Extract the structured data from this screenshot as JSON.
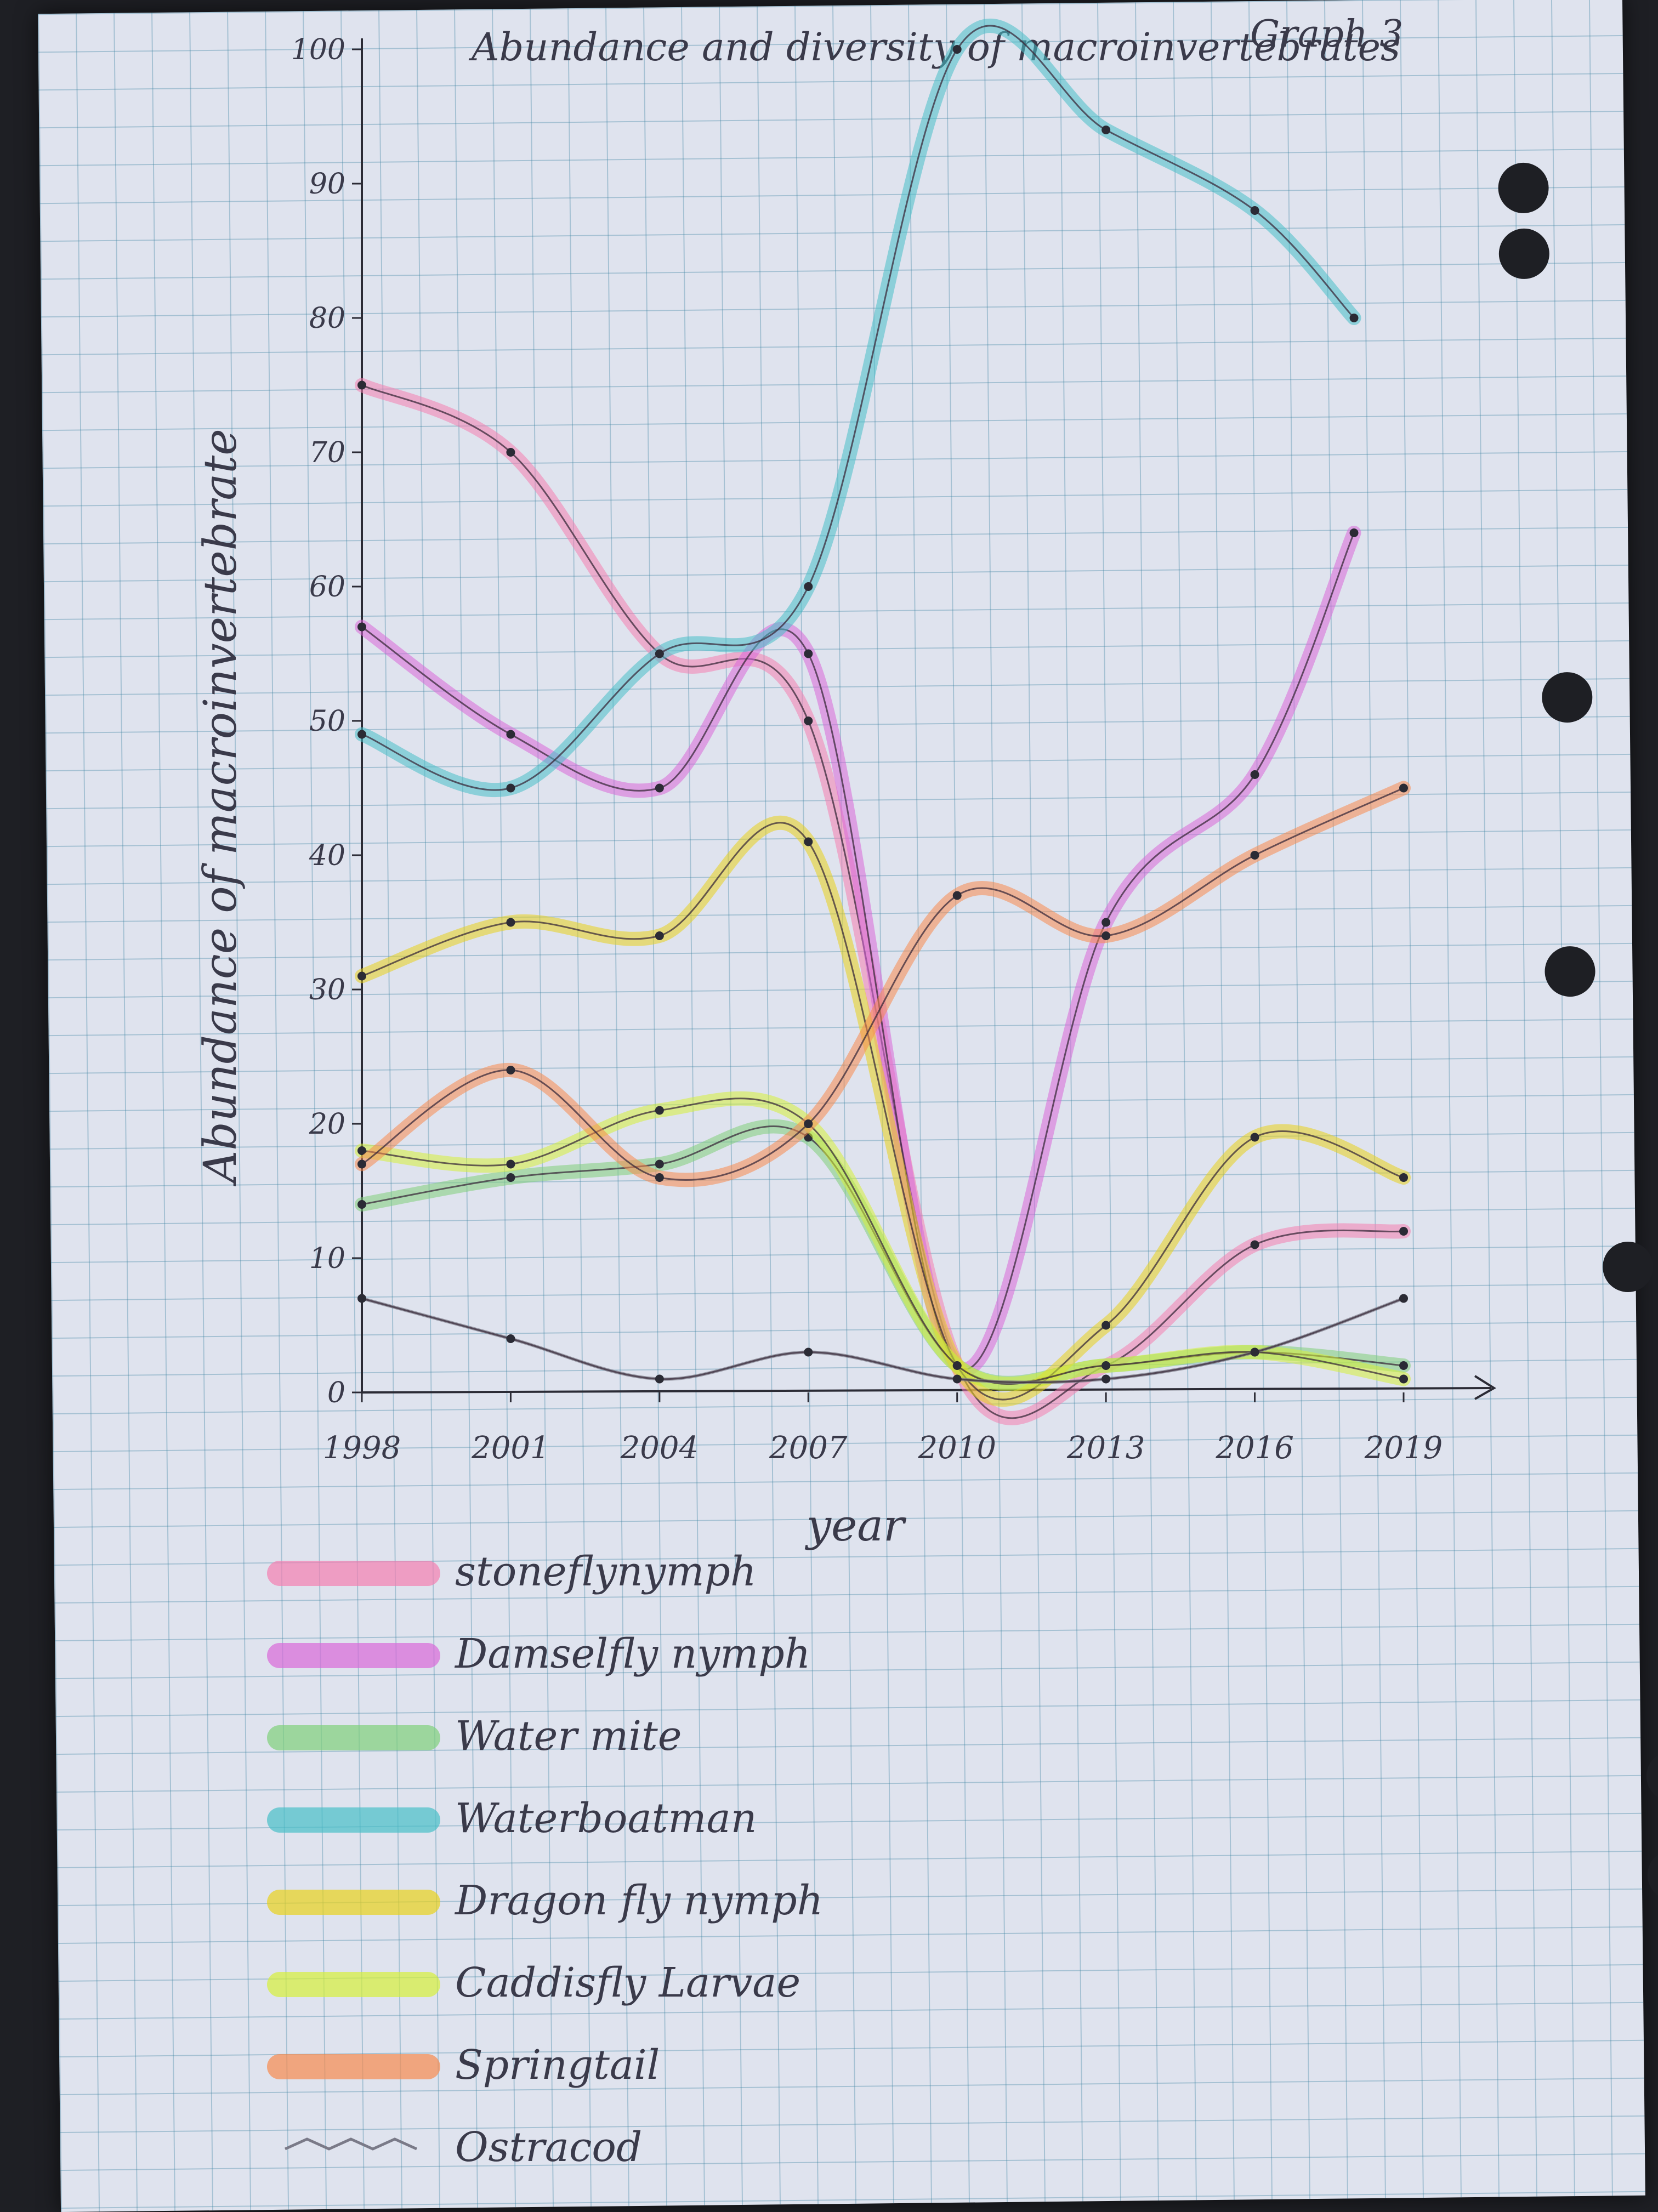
{
  "graph_label": "Graph 3",
  "chart_data": {
    "type": "line",
    "title": "Abundance and diversity of macroinvertebrates",
    "xlabel": "year",
    "ylabel": "Abundance of macroinvertebrate",
    "ylim": [
      0,
      100
    ],
    "y_ticks": [
      0,
      10,
      20,
      30,
      40,
      50,
      60,
      70,
      80,
      90,
      100
    ],
    "x_ticks": [
      1998,
      2001,
      2004,
      2007,
      2010,
      2013,
      2016,
      2019
    ],
    "x_tick_labels": [
      "1998",
      "2001",
      "2004",
      "2007",
      "2010",
      "2013",
      "2016",
      "2019"
    ],
    "grid": true,
    "legend_position": "bottom-left",
    "series": [
      {
        "name": "stoneflynymph",
        "color": "#f47fb0",
        "x": [
          1998,
          2001,
          2004,
          2007,
          2010,
          2013,
          2016,
          2019
        ],
        "values": [
          75,
          70,
          55,
          50,
          2,
          2,
          11,
          12
        ]
      },
      {
        "name": "Damselfly nymph",
        "color": "#d868d8",
        "x": [
          1998,
          2001,
          2004,
          2007,
          2010,
          2013,
          2016,
          2018
        ],
        "values": [
          57,
          49,
          45,
          55,
          2,
          35,
          46,
          64
        ]
      },
      {
        "name": "Water mite",
        "color": "#7fd07a",
        "x": [
          1998,
          2001,
          2004,
          2007,
          2010,
          2013,
          2016,
          2019
        ],
        "values": [
          14,
          16,
          17,
          19,
          2,
          2,
          3,
          2
        ]
      },
      {
        "name": "Waterboatman",
        "color": "#47bfc8",
        "x": [
          1998,
          2001,
          2004,
          2007,
          2010,
          2013,
          2016,
          2018
        ],
        "values": [
          49,
          45,
          55,
          60,
          100,
          94,
          88,
          80
        ]
      },
      {
        "name": "Dragon fly nymph",
        "color": "#e8d21c",
        "x": [
          1998,
          2001,
          2004,
          2007,
          2010,
          2013,
          2016,
          2019
        ],
        "values": [
          31,
          35,
          34,
          41,
          2,
          5,
          19,
          16
        ]
      },
      {
        "name": "Caddisfly Larvae",
        "color": "#d6f03a",
        "x": [
          1998,
          2001,
          2004,
          2007,
          2010,
          2013,
          2016,
          2019
        ],
        "values": [
          18,
          17,
          21,
          20,
          2,
          2,
          3,
          1
        ]
      },
      {
        "name": "Springtail",
        "color": "#f78a4e",
        "x": [
          1998,
          2001,
          2004,
          2007,
          2010,
          2013,
          2016,
          2019
        ],
        "values": [
          17,
          24,
          16,
          20,
          37,
          34,
          40,
          45
        ]
      },
      {
        "name": "Ostracod",
        "color": "#7a7a88",
        "x": [
          1998,
          2001,
          2004,
          2007,
          2010,
          2013,
          2016,
          2019
        ],
        "values": [
          7,
          4,
          1,
          3,
          1,
          1,
          3,
          7
        ]
      }
    ]
  }
}
